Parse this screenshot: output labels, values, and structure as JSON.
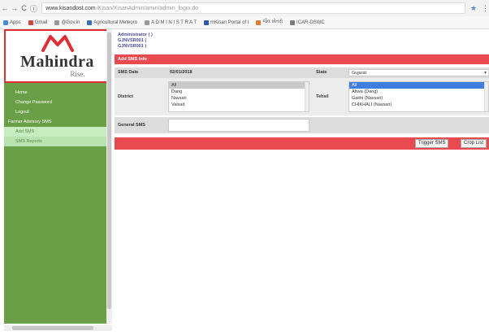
{
  "browser": {
    "back": "←",
    "forward": "→",
    "reload": "C",
    "home": "ⓘ",
    "url_host": "www.kisandost.com",
    "url_path": "/Kisan/KisanAdmin/amin/admin_login.do",
    "star": "★",
    "menu": "⋮"
  },
  "bookmarks": [
    {
      "label": "Apps",
      "color": "#4a8bd8"
    },
    {
      "label": "Gmail",
      "color": "#d44638"
    },
    {
      "label": "@Gov.in",
      "color": "#999999"
    },
    {
      "label": "Agricultural Meteoro",
      "color": "#3b6fb6"
    },
    {
      "label": "A D M I N I S T R A T",
      "color": "#999999"
    },
    {
      "label": "mKisan Portal of I",
      "color": "#2f5aa8"
    },
    {
      "label": "જૈવ ખેતરો",
      "color": "#e07b2b"
    },
    {
      "label": "ICAR-DSWC",
      "color": "#7a7a7a"
    }
  ],
  "sidebar": {
    "logo_text": "Mahindra",
    "logo_tagline": "Rise.",
    "items": [
      {
        "label": "Home",
        "type": "sub"
      },
      {
        "label": "Change Password",
        "type": "sub"
      },
      {
        "label": "Logout",
        "type": "sub"
      },
      {
        "label": "Farmer Advisory SMS",
        "type": "head"
      },
      {
        "label": "Add SMS",
        "type": "active"
      },
      {
        "label": "SMS Reports",
        "type": "active2"
      }
    ]
  },
  "user": {
    "line1": "Administrator ( )",
    "line2": "GJNVSR001 (",
    "line3": "GJNVSR001 )"
  },
  "form": {
    "section_title": "Add SMS Info",
    "sms_date_label": "SMS Date",
    "sms_date_value": "02/01/2018",
    "state_label": "State",
    "state_value": "Gujarat",
    "district_label": "District",
    "district_options": [
      "All",
      "Dang",
      "Navsari",
      "Valsad"
    ],
    "tehsil_label": "Tehsil",
    "tehsil_options": [
      "All",
      "Ahwa (Dang)",
      "Gakhi (Navsari)",
      "CHIKHALI (Navsari)"
    ],
    "general_sms_label": "General SMS",
    "trigger_button": "Trigger SMS",
    "croplist_button": "Crop List"
  }
}
